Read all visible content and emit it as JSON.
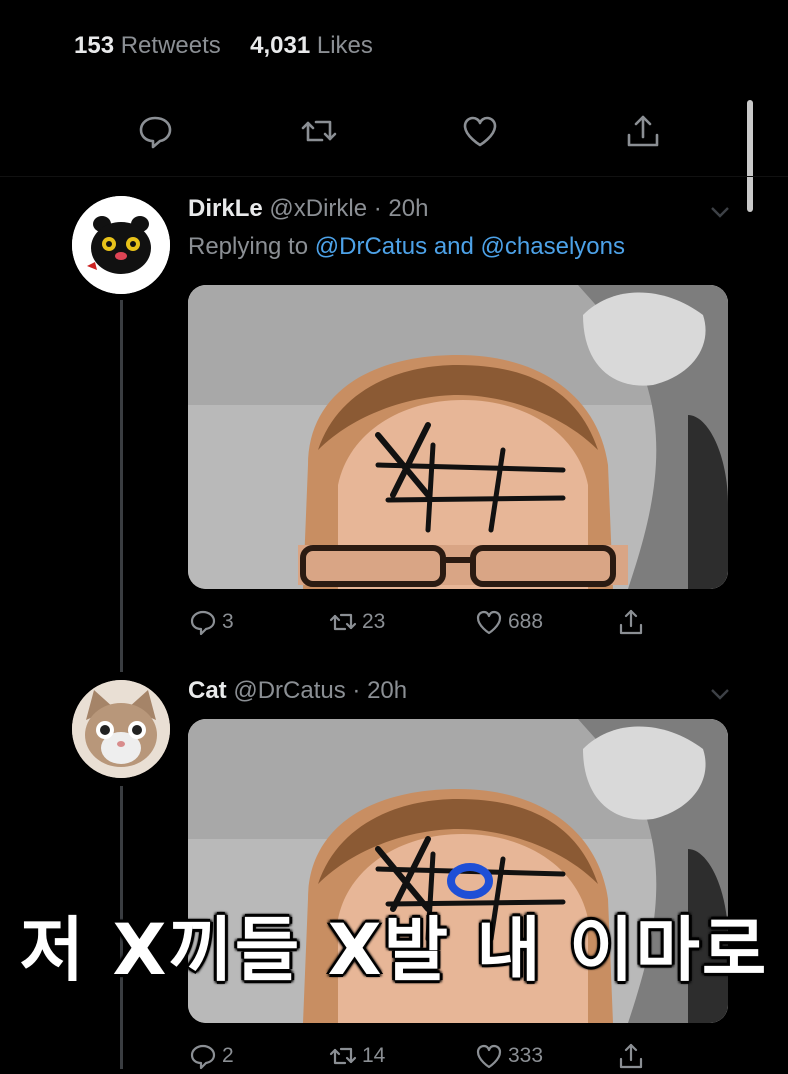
{
  "stats": {
    "retweets_count": "153",
    "retweets_label": "Retweets",
    "likes_count": "4,031",
    "likes_label": "Likes"
  },
  "top_actions": [
    "comment-icon",
    "retweet-icon",
    "heart-icon",
    "share-icon"
  ],
  "tweets": [
    {
      "name": "DirkLe",
      "handle": "@xDirkle",
      "time": "· 20h",
      "replying_prefix": "Replying to",
      "mention_1": "@DrCatus",
      "and_word": "and",
      "mention_2": "@chaselyons",
      "replies": "3",
      "retweets": "23",
      "likes": "688",
      "media_description_icon": "tic-tac-toe-forehead-photo"
    },
    {
      "name": "Cat",
      "handle": "@DrCatus",
      "time": "· 20h",
      "replies": "2",
      "retweets": "14",
      "likes": "333",
      "media_description_icon": "tic-tac-toe-forehead-photo"
    }
  ],
  "subtitle": "저 X끼들 X발 내 이마로",
  "colors": {
    "background": "#000000",
    "muted_text": "#8b8f94",
    "primary_text": "#e9eaeb",
    "link": "#4da2e8",
    "blue_mark": "#1e4fd6"
  }
}
